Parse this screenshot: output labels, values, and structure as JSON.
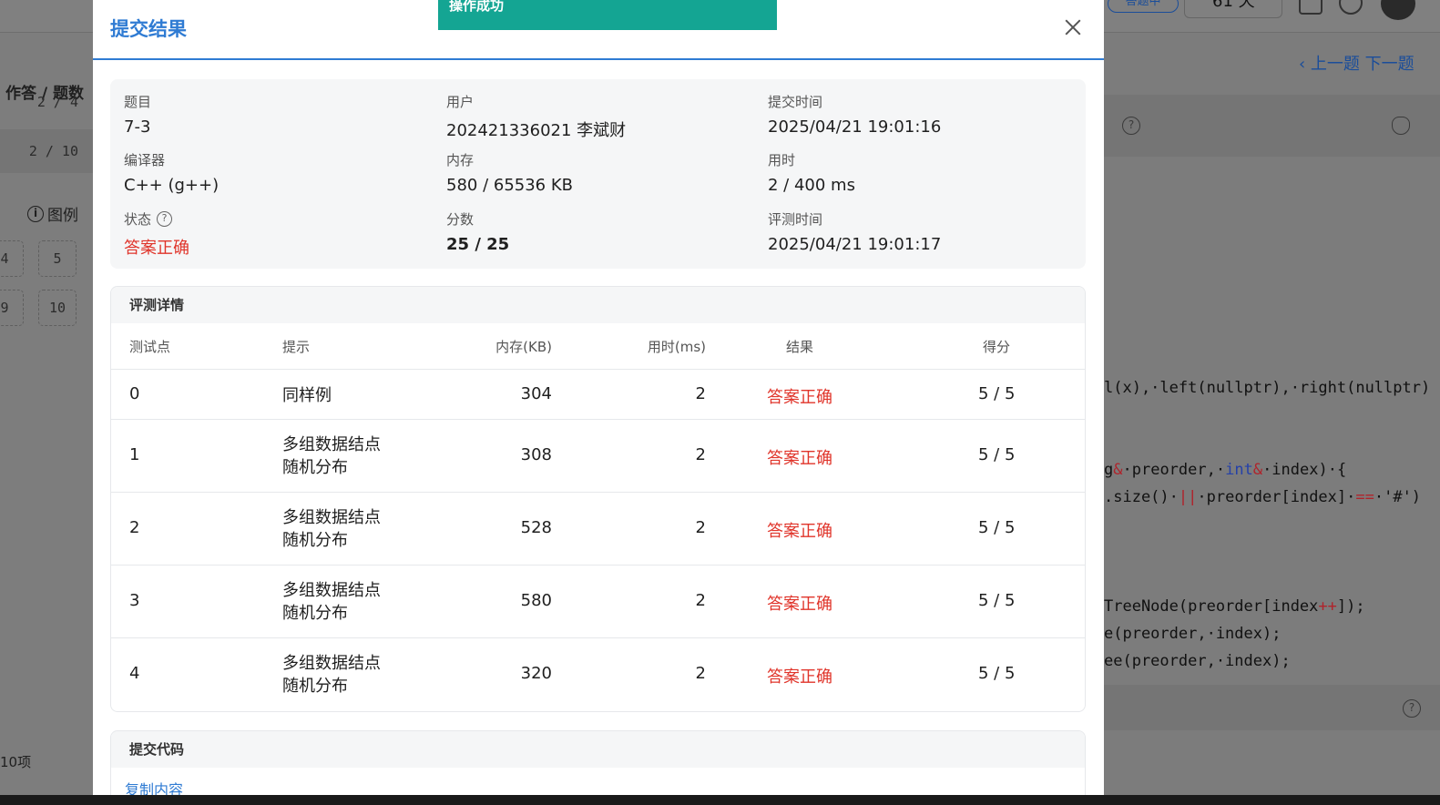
{
  "background": {
    "breadcrumb": "作答 / 题数",
    "rows": [
      "2 / 4",
      "2 / 10"
    ],
    "legend": "图例",
    "legend_icon": "info-icon",
    "cells": [
      "4",
      "5",
      "9",
      "10"
    ],
    "item_count": "10项",
    "nav": "‹ 上一题  下一题",
    "top_pill": "答题中",
    "timer": "61 天",
    "code_lines": [
      {
        "segments": [
          {
            "t": "l(x),·left(nullptr),·right(nullptr)",
            "c": ""
          }
        ]
      },
      {
        "segments": [
          {
            "t": "g",
            "c": ""
          },
          {
            "t": "&",
            "c": "op"
          },
          {
            "t": "·preorder,·",
            "c": ""
          },
          {
            "t": "int",
            "c": "kw"
          },
          {
            "t": "&",
            "c": "op"
          },
          {
            "t": "·index)·{",
            "c": ""
          }
        ]
      },
      {
        "segments": [
          {
            "t": ".size()·",
            "c": ""
          },
          {
            "t": "||",
            "c": "op"
          },
          {
            "t": "·preorder[index]·",
            "c": ""
          },
          {
            "t": "==",
            "c": "op"
          },
          {
            "t": "·'#')",
            "c": ""
          }
        ]
      },
      {
        "segments": [
          {
            "t": "TreeNode(preorder[index",
            "c": ""
          },
          {
            "t": "++",
            "c": "op"
          },
          {
            "t": "]);",
            "c": ""
          }
        ]
      },
      {
        "segments": [
          {
            "t": "e(preorder,·index);",
            "c": ""
          }
        ]
      },
      {
        "segments": [
          {
            "t": "ee(preorder,·index);",
            "c": ""
          }
        ]
      }
    ]
  },
  "toast": "操作成功",
  "modal": {
    "title": "提交结果",
    "info": {
      "problem_label": "题目",
      "problem": "7-3",
      "user_label": "用户",
      "user": "202421336021 李斌财",
      "submit_time_label": "提交时间",
      "submit_time": "2025/04/21 19:01:16",
      "compiler_label": "编译器",
      "compiler": "C++ (g++)",
      "memory_label": "内存",
      "memory": "580 / 65536 KB",
      "time_label": "用时",
      "time": "2 / 400 ms",
      "status_label": "状态",
      "status": "答案正确",
      "score_label": "分数",
      "score": "25 / 25",
      "judge_time_label": "评测时间",
      "judge_time": "2025/04/21 19:01:17"
    },
    "details": {
      "title": "评测详情",
      "headers": [
        "测试点",
        "提示",
        "内存(KB)",
        "用时(ms)",
        "结果",
        "得分"
      ],
      "rows": [
        {
          "id": "0",
          "hint": [
            "同样例"
          ],
          "memory": "304",
          "time": "2",
          "result": "答案正确",
          "score": "5 / 5"
        },
        {
          "id": "1",
          "hint": [
            "多组数据结点",
            "随机分布"
          ],
          "memory": "308",
          "time": "2",
          "result": "答案正确",
          "score": "5 / 5"
        },
        {
          "id": "2",
          "hint": [
            "多组数据结点",
            "随机分布"
          ],
          "memory": "528",
          "time": "2",
          "result": "答案正确",
          "score": "5 / 5"
        },
        {
          "id": "3",
          "hint": [
            "多组数据结点",
            "随机分布"
          ],
          "memory": "580",
          "time": "2",
          "result": "答案正确",
          "score": "5 / 5"
        },
        {
          "id": "4",
          "hint": [
            "多组数据结点",
            "随机分布"
          ],
          "memory": "320",
          "time": "2",
          "result": "答案正确",
          "score": "5 / 5"
        }
      ]
    },
    "code": {
      "title": "提交代码",
      "copy_label": "复制内容"
    }
  },
  "colors": {
    "accent": "#2f7bd3",
    "success_toast": "#14a593",
    "correct": "#e0342a"
  }
}
